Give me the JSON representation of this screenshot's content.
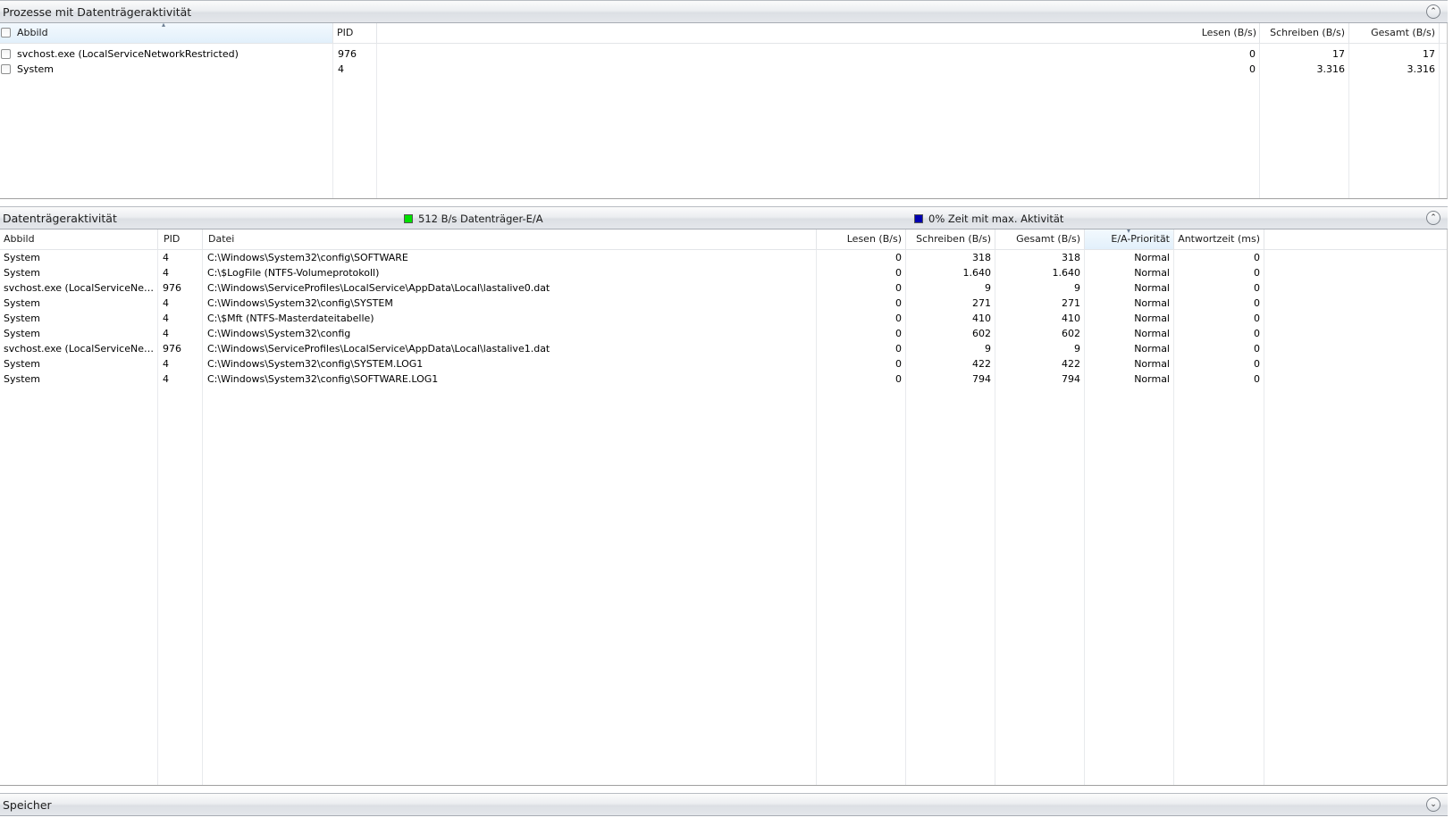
{
  "processes": {
    "title": "Prozesse mit Datenträgeraktivität",
    "columns": {
      "image": "Abbild",
      "pid": "PID",
      "read": "Lesen (B/s)",
      "write": "Schreiben (B/s)",
      "total": "Gesamt (B/s)"
    },
    "rows": [
      {
        "image": "svchost.exe (LocalServiceNetworkRestricted)",
        "pid": "976",
        "read": "0",
        "write": "17",
        "total": "17"
      },
      {
        "image": "System",
        "pid": "4",
        "read": "0",
        "write": "3.316",
        "total": "3.316"
      }
    ]
  },
  "disk_activity": {
    "title": "Datenträgeraktivität",
    "legend_io": {
      "text": "512 B/s Datenträger-E/A",
      "color": "#00e000"
    },
    "legend_time": {
      "text": "0% Zeit mit max. Aktivität",
      "color": "#0000b0"
    },
    "columns": {
      "image": "Abbild",
      "pid": "PID",
      "file": "Datei",
      "read": "Lesen (B/s)",
      "write": "Schreiben (B/s)",
      "total": "Gesamt (B/s)",
      "priority": "E/A-Priorität",
      "response": "Antwortzeit (ms)"
    },
    "rows": [
      {
        "image": "System",
        "pid": "4",
        "file": "C:\\Windows\\System32\\config\\SOFTWARE",
        "read": "0",
        "write": "318",
        "total": "318",
        "priority": "Normal",
        "response": "0"
      },
      {
        "image": "System",
        "pid": "4",
        "file": "C:\\$LogFile (NTFS-Volumeprotokoll)",
        "read": "0",
        "write": "1.640",
        "total": "1.640",
        "priority": "Normal",
        "response": "0"
      },
      {
        "image": "svchost.exe (LocalServiceNetwo...",
        "pid": "976",
        "file": "C:\\Windows\\ServiceProfiles\\LocalService\\AppData\\Local\\lastalive0.dat",
        "read": "0",
        "write": "9",
        "total": "9",
        "priority": "Normal",
        "response": "0"
      },
      {
        "image": "System",
        "pid": "4",
        "file": "C:\\Windows\\System32\\config\\SYSTEM",
        "read": "0",
        "write": "271",
        "total": "271",
        "priority": "Normal",
        "response": "0"
      },
      {
        "image": "System",
        "pid": "4",
        "file": "C:\\$Mft (NTFS-Masterdateitabelle)",
        "read": "0",
        "write": "410",
        "total": "410",
        "priority": "Normal",
        "response": "0"
      },
      {
        "image": "System",
        "pid": "4",
        "file": "C:\\Windows\\System32\\config",
        "read": "0",
        "write": "602",
        "total": "602",
        "priority": "Normal",
        "response": "0"
      },
      {
        "image": "svchost.exe (LocalServiceNetwo...",
        "pid": "976",
        "file": "C:\\Windows\\ServiceProfiles\\LocalService\\AppData\\Local\\lastalive1.dat",
        "read": "0",
        "write": "9",
        "total": "9",
        "priority": "Normal",
        "response": "0"
      },
      {
        "image": "System",
        "pid": "4",
        "file": "C:\\Windows\\System32\\config\\SYSTEM.LOG1",
        "read": "0",
        "write": "422",
        "total": "422",
        "priority": "Normal",
        "response": "0"
      },
      {
        "image": "System",
        "pid": "4",
        "file": "C:\\Windows\\System32\\config\\SOFTWARE.LOG1",
        "read": "0",
        "write": "794",
        "total": "794",
        "priority": "Normal",
        "response": "0"
      }
    ]
  },
  "memory": {
    "title": "Speicher"
  },
  "icons": {
    "collapse": "chevron-up-icon",
    "expand": "chevron-down-icon"
  }
}
